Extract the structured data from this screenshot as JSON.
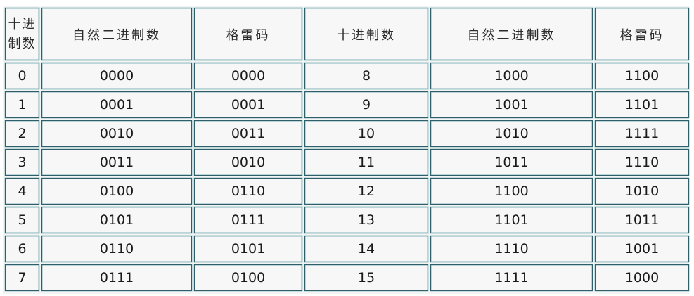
{
  "table": {
    "headers": {
      "decimal_line1": "十进",
      "decimal_line2": "制数",
      "binary_1": "自然二进制数",
      "gray_1": "格雷码",
      "decimal_2": "十进制数",
      "binary_2": "自然二进制数",
      "gray_2": "格雷码"
    },
    "rows": [
      {
        "dec1": "0",
        "bin1": "0000",
        "gray1": "0000",
        "dec2": "8",
        "bin2": "1000",
        "gray2": "1100"
      },
      {
        "dec1": "1",
        "bin1": "0001",
        "gray1": "0001",
        "dec2": "9",
        "bin2": "1001",
        "gray2": "1101"
      },
      {
        "dec1": "2",
        "bin1": "0010",
        "gray1": "0011",
        "dec2": "10",
        "bin2": "1010",
        "gray2": "1111"
      },
      {
        "dec1": "3",
        "bin1": "0011",
        "gray1": "0010",
        "dec2": "11",
        "bin2": "1011",
        "gray2": "1110"
      },
      {
        "dec1": "4",
        "bin1": "0100",
        "gray1": "0110",
        "dec2": "12",
        "bin2": "1100",
        "gray2": "1010"
      },
      {
        "dec1": "5",
        "bin1": "0101",
        "gray1": "0111",
        "dec2": "13",
        "bin2": "1101",
        "gray2": "1011"
      },
      {
        "dec1": "6",
        "bin1": "0110",
        "gray1": "0101",
        "dec2": "14",
        "bin2": "1110",
        "gray2": "1001"
      },
      {
        "dec1": "7",
        "bin1": "0111",
        "gray1": "0100",
        "dec2": "15",
        "bin2": "1111",
        "gray2": "1000"
      }
    ]
  }
}
